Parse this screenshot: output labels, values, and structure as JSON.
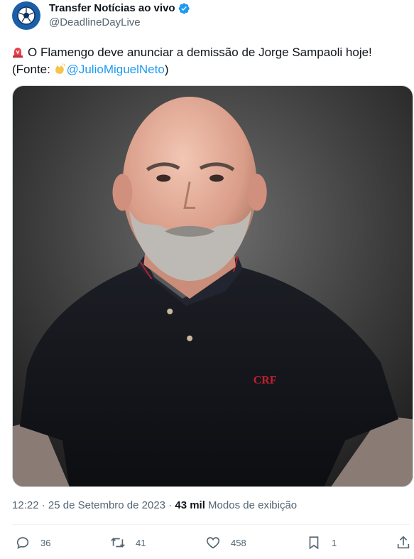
{
  "author": {
    "display_name": "Transfer Notícias ao vivo",
    "handle": "@DeadlineDayLive",
    "verified": true,
    "avatar_icon": "soccer-ball-icon"
  },
  "tweet": {
    "text_main": "O Flamengo deve anunciar a demissão de Jorge Sampaoli hoje!",
    "source_prefix": "(Fonte: ",
    "source_mention": "@JulioMiguelNeto",
    "source_suffix": ")",
    "emoji_leading": "siren-emoji",
    "emoji_source": "clapping-hands-emoji"
  },
  "meta": {
    "time": "12:22",
    "separator": " · ",
    "date": "25 de Setembro de 2023",
    "views_count": "43 mil",
    "views_label": " Modos de exibição"
  },
  "actions": {
    "replies": "36",
    "retweets": "41",
    "likes": "458",
    "bookmarks": "1"
  },
  "colors": {
    "accent": "#1d9bf0",
    "secondary_text": "#536471",
    "primary_text": "#0f1419"
  }
}
